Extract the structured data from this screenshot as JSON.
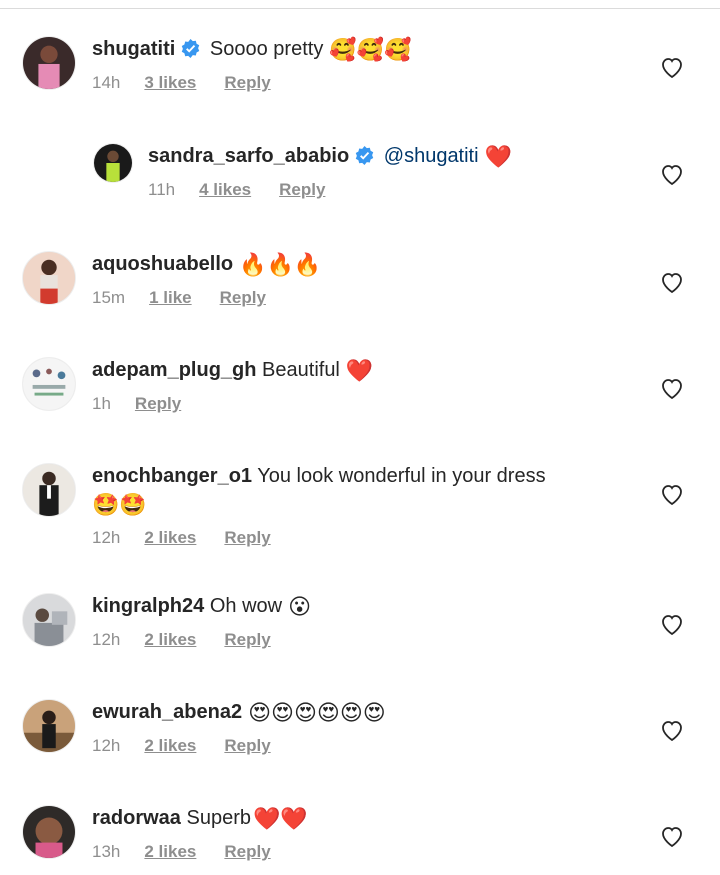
{
  "comments": [
    {
      "username": "shugatiti",
      "verified": true,
      "text": "Soooo pretty",
      "mention": "",
      "emojis": "🥰🥰🥰",
      "time": "14h",
      "likes": "3 likes",
      "reply": "Reply"
    },
    {
      "username": "sandra_sarfo_ababio",
      "verified": true,
      "text": "",
      "mention": "@shugatiti",
      "emojis": "❤️",
      "time": "11h",
      "likes": "4 likes",
      "reply": "Reply"
    },
    {
      "username": "aquoshuabello",
      "verified": false,
      "text": "",
      "mention": "",
      "emojis": "🔥🔥🔥",
      "time": "15m",
      "likes": "1 like",
      "reply": "Reply"
    },
    {
      "username": "adepam_plug_gh",
      "verified": false,
      "text": "Beautiful",
      "mention": "",
      "emojis": "❤️",
      "time": "1h",
      "likes": "",
      "reply": "Reply"
    },
    {
      "username": "enochbanger_o1",
      "verified": false,
      "text": "You look wonderful in your dress",
      "mention": "",
      "emojis": "🤩🤩",
      "time": "12h",
      "likes": "2 likes",
      "reply": "Reply"
    },
    {
      "username": "kingralph24",
      "verified": false,
      "text": "Oh wow",
      "mention": "",
      "emojis": "😮",
      "time": "12h",
      "likes": "2 likes",
      "reply": "Reply"
    },
    {
      "username": "ewurah_abena2",
      "verified": false,
      "text": "",
      "mention": "",
      "emojis": "😍😍😍😍😍😍",
      "time": "12h",
      "likes": "2 likes",
      "reply": "Reply"
    },
    {
      "username": "radorwaa",
      "verified": false,
      "text": "Superb",
      "mention": "",
      "emojis": "❤️❤️",
      "time": "13h",
      "likes": "2 likes",
      "reply": "Reply"
    }
  ],
  "colors": {
    "text": "#262626",
    "meta": "#8e8e8e",
    "mention": "#00376b",
    "verified": "#3897f0",
    "divider": "#dbdbdb"
  },
  "icons": {
    "verified": "verified-badge-icon",
    "like": "heart-outline-icon"
  }
}
